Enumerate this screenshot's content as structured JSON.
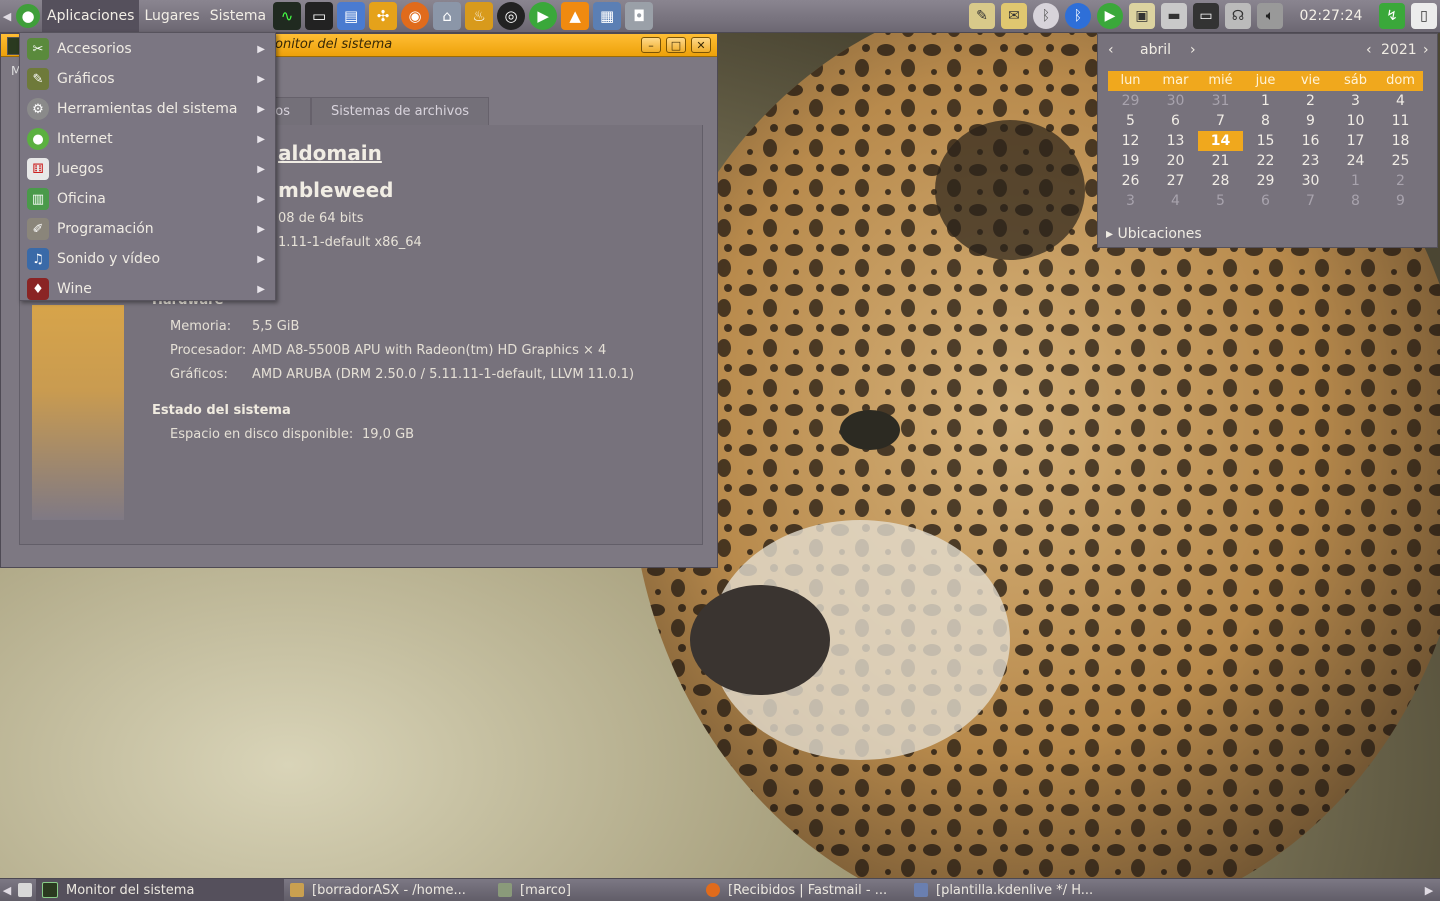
{
  "colors": {
    "accent": "#f0a81d",
    "panel": "#7a7580",
    "window_bg": "#7d7882",
    "titlebar": "#ffb726"
  },
  "top_panel": {
    "menus": [
      "Aplicaciones",
      "Lugares",
      "Sistema"
    ],
    "clock": "02:27:24"
  },
  "window": {
    "title": "Monitor del sistema",
    "title_visible": "onitor del sistema",
    "menu_fragment": "M",
    "tabs": [
      "os",
      "Sistemas de archivos"
    ],
    "hostname_fragment": "aldomain",
    "distro_fragment": "mbleweed",
    "arch_fragment": "08 de 64 bits",
    "kernel_fragment": "1.11-1-default x86_64",
    "hardware_heading": "Hardware",
    "memory_label": "Memoria:",
    "memory_value": "5,5 GiB",
    "processor_label": "Procesador:",
    "processor_value": "AMD A8-5500B APU with Radeon(tm) HD Graphics × 4",
    "graphics_label": "Gráficos:",
    "graphics_value": "AMD ARUBA (DRM 2.50.0 / 5.11.11-1-default, LLVM 11.0.1)",
    "status_heading": "Estado del sistema",
    "disk_label": "Espacio en disco disponible:",
    "disk_value": "19,0 GB"
  },
  "apps_menu": {
    "items": [
      {
        "label": "Accesorios",
        "icon": "accessories-icon"
      },
      {
        "label": "Gráficos",
        "icon": "graphics-icon"
      },
      {
        "label": "Herramientas del sistema",
        "icon": "system-tools-icon"
      },
      {
        "label": "Internet",
        "icon": "internet-icon"
      },
      {
        "label": "Juegos",
        "icon": "games-icon"
      },
      {
        "label": "Oficina",
        "icon": "office-icon"
      },
      {
        "label": "Programación",
        "icon": "programming-icon"
      },
      {
        "label": "Sonido y vídeo",
        "icon": "multimedia-icon"
      },
      {
        "label": "Wine",
        "icon": "wine-icon"
      }
    ]
  },
  "calendar": {
    "month": "abril",
    "year": "2021",
    "weekdays": [
      "lun",
      "mar",
      "mié",
      "jue",
      "vie",
      "sáb",
      "dom"
    ],
    "weeks": [
      [
        "29",
        "30",
        "31",
        "1",
        "2",
        "3",
        "4"
      ],
      [
        "5",
        "6",
        "7",
        "8",
        "9",
        "10",
        "11"
      ],
      [
        "12",
        "13",
        "14",
        "15",
        "16",
        "17",
        "18"
      ],
      [
        "19",
        "20",
        "21",
        "22",
        "23",
        "24",
        "25"
      ],
      [
        "26",
        "27",
        "28",
        "29",
        "30",
        "1",
        "2"
      ],
      [
        "3",
        "4",
        "5",
        "6",
        "7",
        "8",
        "9"
      ]
    ],
    "today": "14",
    "locations_label": "Ubicaciones"
  },
  "taskbar": {
    "tasks": [
      {
        "label": "Monitor del sistema",
        "icon": "system-monitor-icon"
      },
      {
        "label": "[borradorASX - /home...",
        "icon": "text-editor-icon"
      },
      {
        "label": "[marco]",
        "icon": "file-manager-icon"
      },
      {
        "label": "[Recibidos | Fastmail - ...",
        "icon": "firefox-icon"
      },
      {
        "label": "[plantilla.kdenlive */ H...",
        "icon": "kdenlive-icon"
      }
    ]
  }
}
